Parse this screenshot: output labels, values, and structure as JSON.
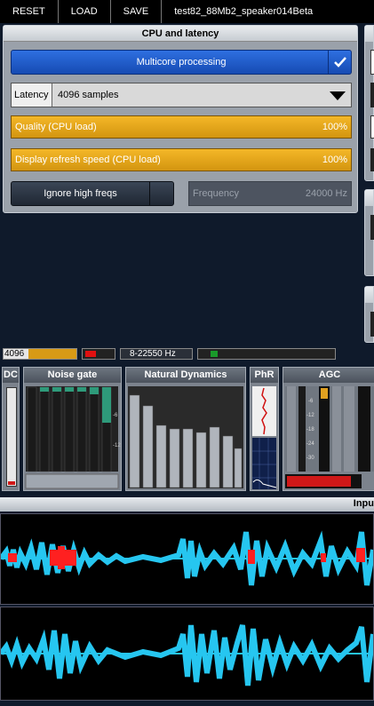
{
  "toolbar": {
    "reset": "RESET",
    "load": "LOAD",
    "save": "SAVE",
    "title": "test82_88Mb2_speaker014Beta"
  },
  "cpu_panel": {
    "title": "CPU and latency",
    "multicore_label": "Multicore processing",
    "latency_label": "Latency",
    "latency_value": "4096 samples",
    "quality_label": "Quality (CPU load)",
    "quality_value": "100%",
    "display_label": "Display refresh speed (CPU load)",
    "display_value": "100%",
    "ignore_label": "Ignore high freqs",
    "frequency_label": "Frequency",
    "frequency_value": "24000 Hz"
  },
  "status": {
    "buffer": "4096",
    "range": "8-22550 Hz"
  },
  "modules": {
    "dc": "DC",
    "noise_gate": "Noise gate",
    "natural_dynamics": "Natural Dynamics",
    "phr": "PhR",
    "agc": "AGC"
  },
  "noise_gate_scale": [
    "-6",
    "-12"
  ],
  "agc_scale": [
    "-6",
    "-12",
    "-18",
    "-24",
    "-30"
  ],
  "wave": {
    "header": "Inpu"
  },
  "colors": {
    "accent_blue": "#1e5ad0",
    "bar_orange": "#e6a41c",
    "wave_cyan": "#26c6f0",
    "wave_red": "#ff2020"
  }
}
